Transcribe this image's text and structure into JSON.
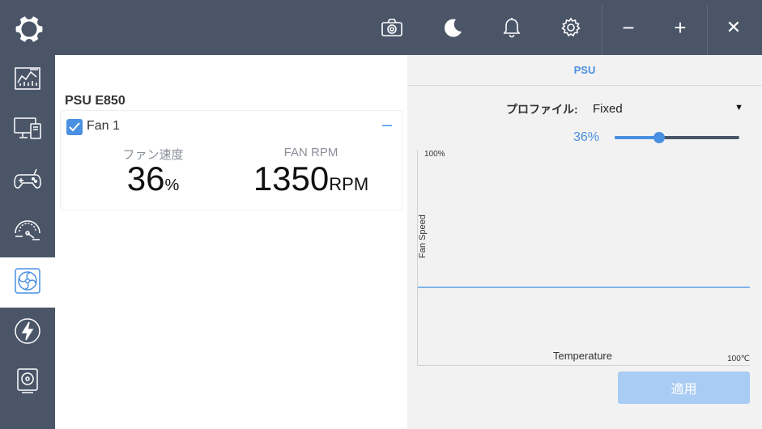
{
  "titlebar": {
    "icons": [
      "camera-icon",
      "moon-icon",
      "bell-icon",
      "gear-icon"
    ],
    "window_controls": {
      "minimize": "−",
      "maximize": "+",
      "close": "✕"
    }
  },
  "sidebar": {
    "items": [
      {
        "icon": "dashboard-icon",
        "active": false
      },
      {
        "icon": "monitor-icon",
        "active": false
      },
      {
        "icon": "gamepad-icon",
        "active": false
      },
      {
        "icon": "gauge-icon",
        "active": false
      },
      {
        "icon": "fan-icon",
        "active": true
      },
      {
        "icon": "power-icon",
        "active": false
      },
      {
        "icon": "storage-icon",
        "active": false
      }
    ]
  },
  "device": {
    "title": "PSU E850",
    "fan": {
      "name": "Fan 1",
      "checked": true,
      "collapse": "–",
      "speed_label": "ファン速度",
      "speed_value": "36",
      "speed_unit": "%",
      "rpm_label": "FAN RPM",
      "rpm_value": "1350",
      "rpm_unit": "RPM"
    }
  },
  "right_panel": {
    "header": "PSU",
    "profile_label": "プロファイル:",
    "profile_value": "Fixed",
    "slider_value_text": "36%",
    "slider_fraction": 0.36,
    "graph": {
      "y_max": "100%",
      "y_label": "Fan Speed",
      "x_label": "Temperature",
      "x_max": "100℃",
      "fixed_speed_fraction": 0.36
    },
    "apply_label": "適用"
  },
  "colors": {
    "chrome": "#4a5568",
    "accent": "#4a90e2",
    "apply_disabled": "#a9ccf4"
  }
}
